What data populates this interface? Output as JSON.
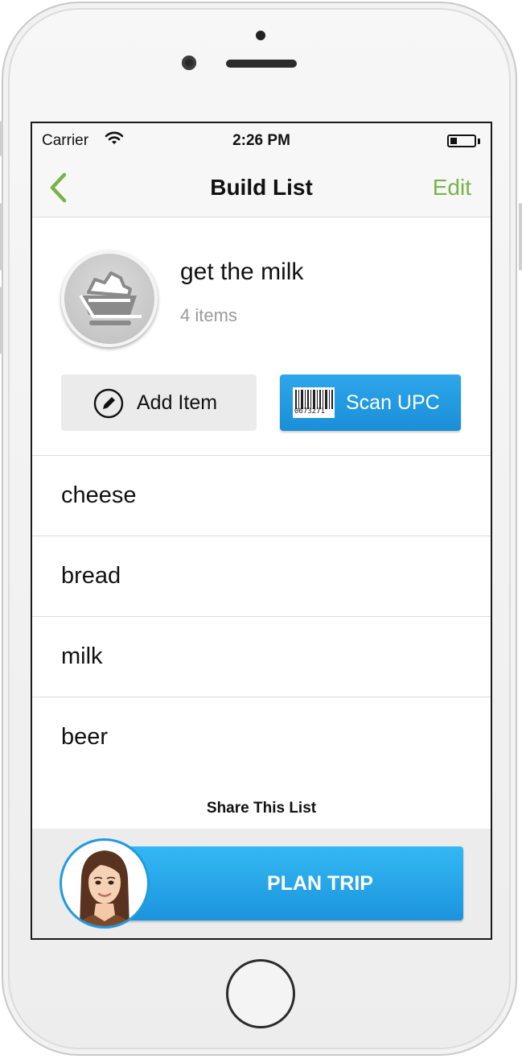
{
  "statusbar": {
    "carrier": "Carrier",
    "time": "2:26 PM"
  },
  "navbar": {
    "title": "Build List",
    "edit_label": "Edit"
  },
  "list": {
    "name": "get the milk",
    "count": "4 items"
  },
  "actions": {
    "add_item_label": "Add Item",
    "scan_label": "Scan UPC",
    "barcode_number": "0673271"
  },
  "items": [
    {
      "label": "cheese"
    },
    {
      "label": "bread"
    },
    {
      "label": "milk"
    },
    {
      "label": "beer"
    }
  ],
  "share_label": "Share This List",
  "plan_trip_label": "PLAN TRIP",
  "colors": {
    "accent_green": "#78b347",
    "accent_blue": "#1f9be0"
  }
}
